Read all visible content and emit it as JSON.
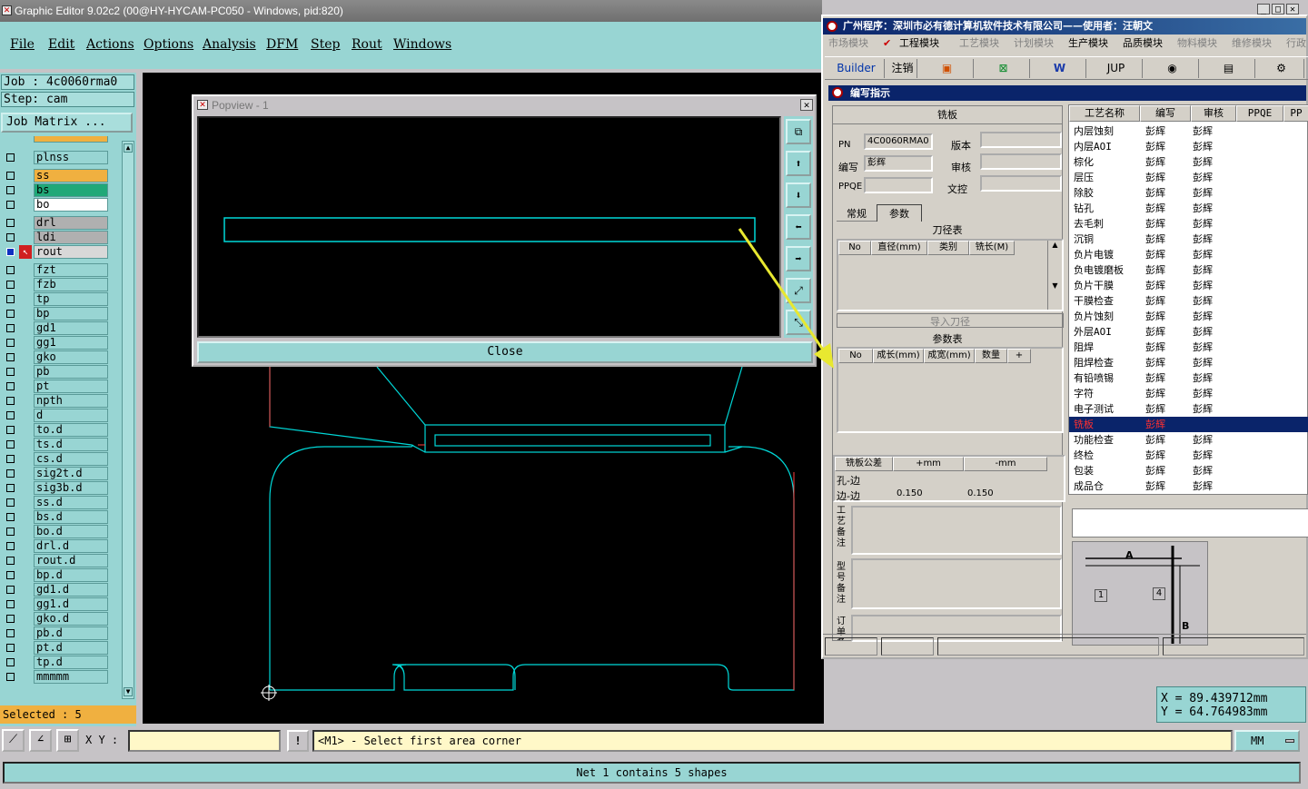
{
  "window": {
    "title": "Graphic Editor 9.02c2 (00@HY-HYCAM-PC050 - Windows, pid:820)"
  },
  "menu": [
    "File",
    "Edit",
    "Actions",
    "Options",
    "Analysis",
    "DFM",
    "Step",
    "Rout",
    "Windows"
  ],
  "job": {
    "job_line": "Job : 4c0060rma0",
    "step_line": "Step: cam",
    "matrix_button": "Job Matrix ..."
  },
  "layers": [
    {
      "name": "plnss",
      "color": "#98d5d3"
    },
    {
      "name": "ss",
      "color": "#f0b040"
    },
    {
      "name": "bs",
      "color": "#20a878"
    },
    {
      "name": "bo",
      "color": "#ffffff"
    },
    {
      "name": "drl",
      "color": "#b0b0b0"
    },
    {
      "name": "ldi",
      "color": "#b0b0b0"
    },
    {
      "name": "rout",
      "color": "#d8d8d8",
      "active": true
    },
    {
      "name": "fzt",
      "color": "#98d5d3"
    },
    {
      "name": "fzb",
      "color": "#98d5d3"
    },
    {
      "name": "tp",
      "color": "#98d5d3"
    },
    {
      "name": "bp",
      "color": "#98d5d3"
    },
    {
      "name": "gd1",
      "color": "#98d5d3"
    },
    {
      "name": "gg1",
      "color": "#98d5d3"
    },
    {
      "name": "gko",
      "color": "#98d5d3"
    },
    {
      "name": "pb",
      "color": "#98d5d3"
    },
    {
      "name": "pt",
      "color": "#98d5d3"
    },
    {
      "name": "npth",
      "color": "#98d5d3"
    },
    {
      "name": "d",
      "color": "#98d5d3"
    },
    {
      "name": "to.d",
      "color": "#98d5d3"
    },
    {
      "name": "ts.d",
      "color": "#98d5d3"
    },
    {
      "name": "cs.d",
      "color": "#98d5d3"
    },
    {
      "name": "sig2t.d",
      "color": "#98d5d3"
    },
    {
      "name": "sig3b.d",
      "color": "#98d5d3"
    },
    {
      "name": "ss.d",
      "color": "#98d5d3"
    },
    {
      "name": "bs.d",
      "color": "#98d5d3"
    },
    {
      "name": "bo.d",
      "color": "#98d5d3"
    },
    {
      "name": "drl.d",
      "color": "#98d5d3"
    },
    {
      "name": "rout.d",
      "color": "#98d5d3"
    },
    {
      "name": "bp.d",
      "color": "#98d5d3"
    },
    {
      "name": "gd1.d",
      "color": "#98d5d3"
    },
    {
      "name": "gg1.d",
      "color": "#98d5d3"
    },
    {
      "name": "gko.d",
      "color": "#98d5d3"
    },
    {
      "name": "pb.d",
      "color": "#98d5d3"
    },
    {
      "name": "pt.d",
      "color": "#98d5d3"
    },
    {
      "name": "tp.d",
      "color": "#98d5d3"
    },
    {
      "name": "mmmmm",
      "color": "#98d5d3"
    }
  ],
  "selected": "Selected : 5",
  "popview": {
    "title": "Popview - 1",
    "close_label": "Close"
  },
  "command": {
    "xy_label": "X Y :",
    "xy_value": "",
    "prompt": "<M1> - Select first area corner",
    "units": "MM"
  },
  "status": "Net 1 contains 5 shapes",
  "coords": {
    "x": "X = 89.439712mm",
    "y": "Y = 64.764983mm"
  },
  "erp": {
    "title": "广州程序：深圳市必有德计算机软件技术有限公司——使用者：汪朝文",
    "modules": [
      "市场模块",
      "工程模块",
      "工艺模块",
      "计划模块",
      "生产模块",
      "品质模块",
      "物料模块",
      "维修模块",
      "行政"
    ],
    "toolbar": [
      "Builder",
      "注销",
      "JUP"
    ],
    "section_title": "编写指示",
    "form": {
      "heading": "铣板",
      "pn_label": "PN",
      "pn_value": "4C0060RMA0",
      "version_label": "版本",
      "version_value": "",
      "writer_label": "编写",
      "writer_value": "彭辉",
      "review_label": "审核",
      "review_value": "",
      "ppqe_label": "PPQE",
      "ppqe_value": "",
      "doc_label": "文控",
      "doc_value": "",
      "tab_general": "常规",
      "tab_params": "参数",
      "cutter_title": "刀径表",
      "cutter_cols": [
        "No",
        "直径(mm)",
        "类别",
        "铣长(M)"
      ],
      "import_btn": "导入刀径",
      "param_title": "参数表",
      "param_cols": [
        "No",
        "成长(mm)",
        "成宽(mm)",
        "数量",
        "+"
      ],
      "tol_cols": [
        "铣板公差",
        "+mm",
        "-mm"
      ],
      "tol_rows": [
        {
          "name": "孔-边",
          "plus": "",
          "minus": ""
        },
        {
          "name": "边-边",
          "plus": "0.150",
          "minus": "0.150"
        }
      ],
      "note1_label": "工艺备注",
      "note2_label": "型号备注",
      "note3_label": "订单备"
    },
    "process_cols": [
      "工艺名称",
      "编写",
      "审核",
      "PPQE",
      "PP"
    ],
    "processes": [
      {
        "name": "内层蚀刻",
        "writer": "彭辉",
        "reviewer": "彭辉"
      },
      {
        "name": "内层AOI",
        "writer": "彭辉",
        "reviewer": "彭辉"
      },
      {
        "name": "棕化",
        "writer": "彭辉",
        "reviewer": "彭辉"
      },
      {
        "name": "层压",
        "writer": "彭辉",
        "reviewer": "彭辉"
      },
      {
        "name": "除胶",
        "writer": "彭辉",
        "reviewer": "彭辉"
      },
      {
        "name": "钻孔",
        "writer": "彭辉",
        "reviewer": "彭辉"
      },
      {
        "name": "去毛刺",
        "writer": "彭辉",
        "reviewer": "彭辉"
      },
      {
        "name": "沉铜",
        "writer": "彭辉",
        "reviewer": "彭辉"
      },
      {
        "name": "负片电镀",
        "writer": "彭辉",
        "reviewer": "彭辉"
      },
      {
        "name": "负电镀磨板",
        "writer": "彭辉",
        "reviewer": "彭辉"
      },
      {
        "name": "负片干膜",
        "writer": "彭辉",
        "reviewer": "彭辉"
      },
      {
        "name": "干膜检查",
        "writer": "彭辉",
        "reviewer": "彭辉"
      },
      {
        "name": "负片蚀刻",
        "writer": "彭辉",
        "reviewer": "彭辉"
      },
      {
        "name": "外层AOI",
        "writer": "彭辉",
        "reviewer": "彭辉"
      },
      {
        "name": "阻焊",
        "writer": "彭辉",
        "reviewer": "彭辉"
      },
      {
        "name": "阻焊检查",
        "writer": "彭辉",
        "reviewer": "彭辉"
      },
      {
        "name": "有铅喷锡",
        "writer": "彭辉",
        "reviewer": "彭辉"
      },
      {
        "name": "字符",
        "writer": "彭辉",
        "reviewer": "彭辉"
      },
      {
        "name": "电子测试",
        "writer": "彭辉",
        "reviewer": "彭辉"
      },
      {
        "name": "铣板",
        "writer": "彭辉",
        "reviewer": "",
        "selected": true
      },
      {
        "name": "功能检查",
        "writer": "彭辉",
        "reviewer": "彭辉"
      },
      {
        "name": "终检",
        "writer": "彭辉",
        "reviewer": "彭辉"
      },
      {
        "name": "包装",
        "writer": "彭辉",
        "reviewer": "彭辉"
      },
      {
        "name": "成品仓",
        "writer": "彭辉",
        "reviewer": "彭辉"
      }
    ],
    "diagram": {
      "a": "A",
      "b": "B",
      "n1": "1",
      "n4": "4"
    }
  },
  "colors": {
    "accent": "#98d5d3",
    "outline": "#00e5e5",
    "highlight_arrow": "#e8e830",
    "selected_row": "#0a246a"
  }
}
